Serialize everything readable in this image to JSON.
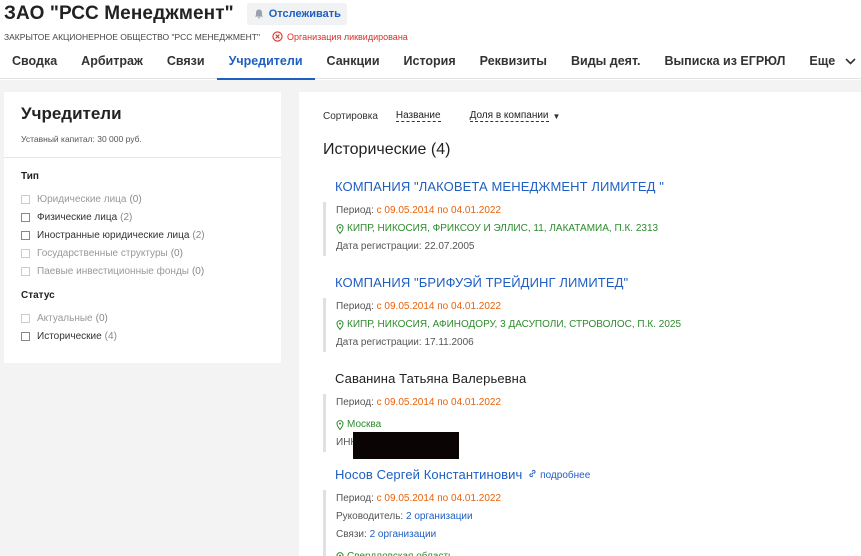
{
  "header": {
    "title": "ЗАО \"РСС Менеджмент\"",
    "follow_label": "Отслеживать",
    "full_name": "ЗАКРЫТОЕ АКЦИОНЕРНОЕ ОБЩЕСТВО \"РСС МЕНЕДЖМЕНТ\"",
    "status": "Организация ликвидирована",
    "status_color": "#d93025"
  },
  "tabs": [
    {
      "label": "Сводка"
    },
    {
      "label": "Арбитраж"
    },
    {
      "label": "Связи"
    },
    {
      "label": "Учредители",
      "active": true
    },
    {
      "label": "Санкции"
    },
    {
      "label": "История"
    },
    {
      "label": "Реквизиты"
    },
    {
      "label": "Виды деят."
    },
    {
      "label": "Выписка из ЕГРЮЛ"
    },
    {
      "label": "Еще"
    }
  ],
  "sidebar": {
    "title": "Учредители",
    "capital": "Уставный капитал: 30 000 руб.",
    "type_title": "Тип",
    "types": [
      {
        "label": "Юридические лица",
        "count": "(0)",
        "disabled": true
      },
      {
        "label": "Физические лица",
        "count": "(2)",
        "disabled": false
      },
      {
        "label": "Иностранные юридические лица",
        "count": "(2)",
        "disabled": false
      },
      {
        "label": "Государственные структуры",
        "count": "(0)",
        "disabled": true
      },
      {
        "label": "Паевые инвестиционные фонды",
        "count": "(0)",
        "disabled": true
      }
    ],
    "status_title": "Статус",
    "statuses": [
      {
        "label": "Актуальные",
        "count": "(0)",
        "disabled": true
      },
      {
        "label": "Исторические",
        "count": "(4)",
        "disabled": false
      }
    ]
  },
  "main": {
    "sort_label": "Сортировка",
    "sort_name": "Название",
    "sort_share": "Доля в компании",
    "section_title": "Исторические (4)",
    "entries": [
      {
        "name": "КОМПАНИЯ \"ЛАКОВЕТА МЕНЕДЖМЕНТ ЛИМИТЕД \"",
        "period_label": "Период:",
        "period": "с 09.05.2014 по 04.01.2022",
        "address": "КИПР, НИКОСИЯ, ФРИКСОУ И ЭЛЛИС, 11, ЛАКАТАМИА, П.К. 2313",
        "reg": "Дата регистрации: 22.07.2005"
      },
      {
        "name": "КОМПАНИЯ \"БРИФУЭЙ ТРЕЙДИНГ ЛИМИТЕД\"",
        "period_label": "Период:",
        "period": "с 09.05.2014 по 04.01.2022",
        "address": "КИПР, НИКОСИЯ, АФИНОДОРУ, 3 ДАСУПОЛИ, СТРОВОЛОС, П.К. 2025",
        "reg": "Дата регистрации: 17.11.2006"
      },
      {
        "name": "Саванина Татьяна Валерьевна",
        "period_label": "Период:",
        "period": "с 09.05.2014 по 04.01.2022",
        "address": "Москва",
        "inn_label": "ИНН"
      },
      {
        "name": "Носов Сергей Константинович",
        "more": "подробнее",
        "period_label": "Период:",
        "period": "с 09.05.2014 по 04.01.2022",
        "head_label": "Руководитель:",
        "head_value": "2 организации",
        "links_label": "Связи:",
        "links_value": "2 организации",
        "address": "Свердловская область"
      }
    ]
  },
  "colors": {
    "accent": "#1f5fc2",
    "period": "#e8630a",
    "address": "#2e8b2e"
  }
}
